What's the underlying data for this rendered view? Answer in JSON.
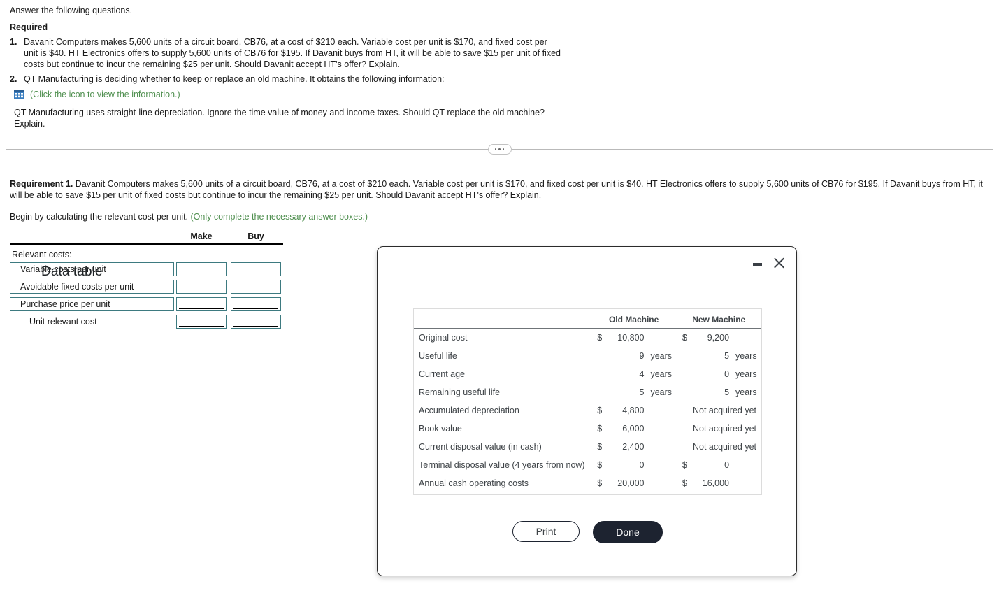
{
  "problem": {
    "intro": "Answer the following questions.",
    "required_heading": "Required",
    "questions": [
      {
        "num": "1.",
        "text": "Davanit Computers makes 5,600 units of a circuit board, CB76, at a cost of $210 each. Variable cost per unit is $170, and fixed cost per unit is $40. HT Electronics offers to supply 5,600 units of CB76 for $195. If Davanit buys from HT, it will be able to save $15 per unit of fixed costs but continue to incur the remaining $25 per unit. Should Davanit accept HT's offer? Explain."
      },
      {
        "num": "2.",
        "text": "QT Manufacturing is deciding whether to keep or replace an old machine. It obtains the following information:"
      }
    ],
    "icon_link_text": "(Click the icon to view the information.)",
    "icon_name": "table-grid-icon",
    "sub_paragraph": "QT Manufacturing uses straight-line depreciation. Ignore the time value of money and income taxes. Should QT replace the old machine? Explain."
  },
  "divider": {
    "handle_name": "collapse-handle-ellipsis"
  },
  "requirement": {
    "label": "Requirement 1.",
    "text": "Davanit Computers makes 5,600 units of a circuit board, CB76, at a cost of $210 each. Variable cost per unit is $170, and fixed cost per unit is $40. HT Electronics offers to supply 5,600 units of CB76 for $195. If Davanit buys from HT, it will be able to save $15 per unit of fixed costs but continue to incur the remaining $25 per unit. Should Davanit accept HT's offer? Explain.",
    "begin_text": "Begin by calculating the relevant cost per unit.",
    "hint_text": "(Only complete the necessary answer boxes.)"
  },
  "answer_table": {
    "columns": [
      "Make",
      "Buy"
    ],
    "section_label": "Relevant costs:",
    "rows": [
      {
        "label": "Variable costs per unit",
        "make": "",
        "buy": "",
        "underline": "none",
        "boxed_label": true
      },
      {
        "label": "Avoidable fixed costs per unit",
        "make": "",
        "buy": "",
        "underline": "none",
        "boxed_label": true
      },
      {
        "label": "Purchase price per unit",
        "make": "",
        "buy": "",
        "underline": "single",
        "boxed_label": true
      },
      {
        "label": "Unit relevant cost",
        "make": "",
        "buy": "",
        "underline": "double",
        "boxed_label": false
      }
    ]
  },
  "modal": {
    "title": "Data table",
    "minimize_label": "Minimize",
    "close_label": "Close",
    "buttons": {
      "print": "Print",
      "done": "Done"
    },
    "table": {
      "headers": [
        "",
        "Old Machine",
        "New Machine"
      ],
      "rows": [
        {
          "name": "Original cost",
          "old_sym": "$",
          "old_num": "10,800",
          "old_unit": "",
          "new_sym": "$",
          "new_num": "9,200",
          "new_unit": "",
          "new_note": ""
        },
        {
          "name": "Useful life",
          "old_sym": "",
          "old_num": "9",
          "old_unit": "years",
          "new_sym": "",
          "new_num": "5",
          "new_unit": "years",
          "new_note": ""
        },
        {
          "name": "Current age",
          "old_sym": "",
          "old_num": "4",
          "old_unit": "years",
          "new_sym": "",
          "new_num": "0",
          "new_unit": "years",
          "new_note": ""
        },
        {
          "name": "Remaining useful life",
          "old_sym": "",
          "old_num": "5",
          "old_unit": "years",
          "new_sym": "",
          "new_num": "5",
          "new_unit": "years",
          "new_note": ""
        },
        {
          "name": "Accumulated depreciation",
          "old_sym": "$",
          "old_num": "4,800",
          "old_unit": "",
          "new_sym": "",
          "new_num": "",
          "new_unit": "",
          "new_note": "Not acquired yet"
        },
        {
          "name": "Book value",
          "old_sym": "$",
          "old_num": "6,000",
          "old_unit": "",
          "new_sym": "",
          "new_num": "",
          "new_unit": "",
          "new_note": "Not acquired yet"
        },
        {
          "name": "Current disposal value (in cash)",
          "old_sym": "$",
          "old_num": "2,400",
          "old_unit": "",
          "new_sym": "",
          "new_num": "",
          "new_unit": "",
          "new_note": "Not acquired yet"
        },
        {
          "name": "Terminal disposal value (4 years from now)",
          "old_sym": "$",
          "old_num": "0",
          "old_unit": "",
          "new_sym": "$",
          "new_num": "0",
          "new_unit": "",
          "new_note": ""
        },
        {
          "name": "Annual cash operating costs",
          "old_sym": "$",
          "old_num": "20,000",
          "old_unit": "",
          "new_sym": "$",
          "new_num": "16,000",
          "new_unit": "",
          "new_note": ""
        }
      ]
    }
  },
  "colors": {
    "hint_green": "#4f8f4f",
    "input_border": "#3d7a80",
    "done_button": "#1d2330",
    "icon_blue": "#3a7ec0"
  }
}
